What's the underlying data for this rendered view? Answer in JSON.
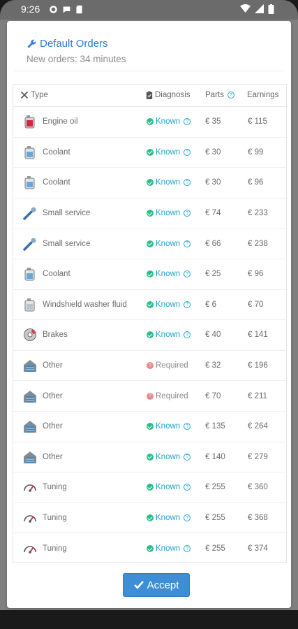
{
  "status_bar": {
    "time": "9:26"
  },
  "header": {
    "title": "Default Orders",
    "subtitle": "New orders: 34 minutes"
  },
  "table": {
    "columns": {
      "type": "Type",
      "diagnosis": "Diagnosis",
      "parts": "Parts",
      "earnings": "Earnings"
    },
    "rows": [
      {
        "icon": "engine-oil-icon",
        "type": "Engine oil",
        "diagnosis": "Known",
        "parts": "€ 35",
        "earnings": "€ 115"
      },
      {
        "icon": "coolant-icon",
        "type": "Coolant",
        "diagnosis": "Known",
        "parts": "€ 30",
        "earnings": "€ 99"
      },
      {
        "icon": "coolant-icon",
        "type": "Coolant",
        "diagnosis": "Known",
        "parts": "€ 30",
        "earnings": "€ 96"
      },
      {
        "icon": "small-service-icon",
        "type": "Small service",
        "diagnosis": "Known",
        "parts": "€ 74",
        "earnings": "€ 233"
      },
      {
        "icon": "small-service-icon",
        "type": "Small service",
        "diagnosis": "Known",
        "parts": "€ 66",
        "earnings": "€ 238"
      },
      {
        "icon": "coolant-icon",
        "type": "Coolant",
        "diagnosis": "Known",
        "parts": "€ 25",
        "earnings": "€ 96"
      },
      {
        "icon": "washer-fluid-icon",
        "type": "Windshield washer fluid",
        "diagnosis": "Known",
        "parts": "€ 6",
        "earnings": "€ 70"
      },
      {
        "icon": "brakes-icon",
        "type": "Brakes",
        "diagnosis": "Known",
        "parts": "€ 40",
        "earnings": "€ 141"
      },
      {
        "icon": "garage-icon",
        "type": "Other",
        "diagnosis": "Required",
        "parts": "€ 32",
        "earnings": "€ 196"
      },
      {
        "icon": "garage-icon",
        "type": "Other",
        "diagnosis": "Required",
        "parts": "€ 70",
        "earnings": "€ 211"
      },
      {
        "icon": "garage-icon",
        "type": "Other",
        "diagnosis": "Known",
        "parts": "€ 135",
        "earnings": "€ 264"
      },
      {
        "icon": "garage-icon",
        "type": "Other",
        "diagnosis": "Known",
        "parts": "€ 140",
        "earnings": "€ 279"
      },
      {
        "icon": "speedometer-icon",
        "type": "Tuning",
        "diagnosis": "Known",
        "parts": "€ 255",
        "earnings": "€ 360"
      },
      {
        "icon": "speedometer-icon",
        "type": "Tuning",
        "diagnosis": "Known",
        "parts": "€ 255",
        "earnings": "€ 368"
      },
      {
        "icon": "speedometer-icon",
        "type": "Tuning",
        "diagnosis": "Known",
        "parts": "€ 255",
        "earnings": "€ 374"
      }
    ]
  },
  "accept_label": "Accept",
  "colors": {
    "accent": "#3d8ed4",
    "known": "#27a1c9",
    "check": "#2ebd8a",
    "required": "#e58b8b"
  }
}
